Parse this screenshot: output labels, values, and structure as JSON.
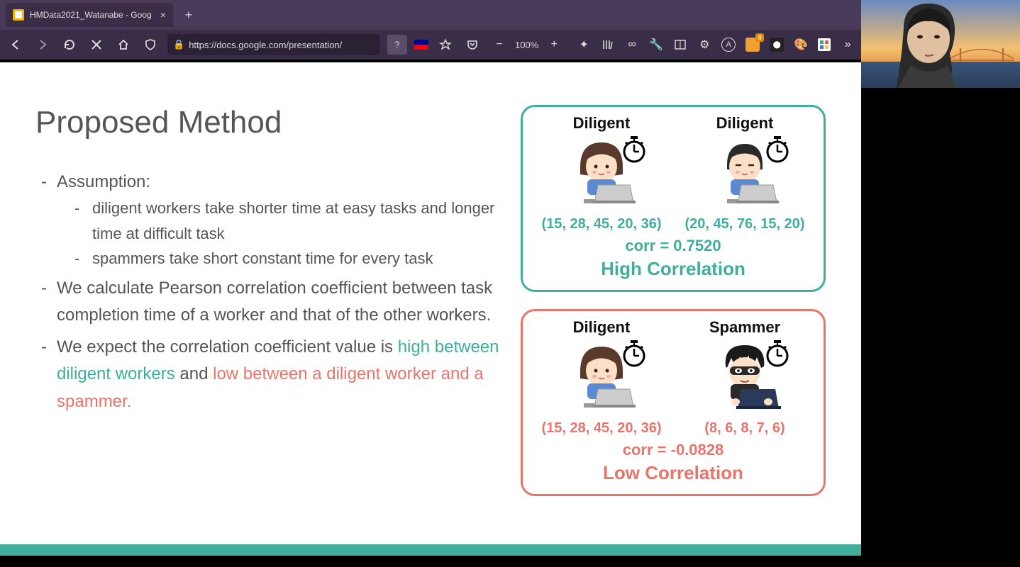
{
  "browser": {
    "tab_title": "HMData2021_Watanabe - Goog",
    "url": "https://docs.google.com/presentation/",
    "zoom": "100%"
  },
  "slide": {
    "title": "Proposed Method",
    "bullet1": "Assumption:",
    "bullet1a": "diligent workers take shorter time at easy tasks and longer time at difficult task",
    "bullet1b": "spammers take short constant time for every task",
    "bullet2": "We calculate Pearson correlation coefficient between task completion time of a worker and that of the other workers.",
    "bullet3_pre": "We expect the correlation coefficient value is ",
    "bullet3_high": "high between diligent workers",
    "bullet3_and": " and ",
    "bullet3_low": "low between a diligent worker and a spammer."
  },
  "card_high": {
    "worker1_label": "Diligent",
    "worker2_label": "Diligent",
    "worker1_nums": "(15, 28, 45, 20, 36)",
    "worker2_nums": "(20, 45, 76, 15, 20)",
    "corr": "corr = 0.7520",
    "label": "High Correlation"
  },
  "card_low": {
    "worker1_label": "Diligent",
    "worker2_label": "Spammer",
    "worker1_nums": "(15, 28, 45, 20, 36)",
    "worker2_nums": "(8, 6, 8, 7, 6)",
    "corr": "corr = -0.0828",
    "label": "Low Correlation"
  }
}
